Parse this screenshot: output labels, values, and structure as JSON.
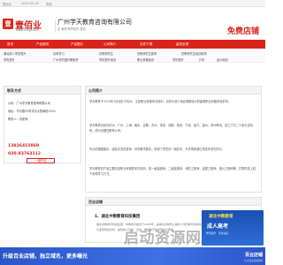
{
  "topbar": {
    "site": "壹佰业",
    "date": "2025-05-26",
    "login": "登录"
  },
  "header": {
    "logo_mark": "壹",
    "logo_text": "壹佰业",
    "logo_url": "www.100ye.com",
    "company_name": "广州学天教育咨询有限公司",
    "company_tags": "企 管理  教育培训  咨询",
    "free_store": "免费店铺"
  },
  "nav": {
    "items": [
      "首页",
      "产品服务",
      "产品图片",
      "公司简介",
      "文件下载",
      "留言反馈"
    ]
  },
  "subnav": {
    "items": [
      "湖北成人学历提升",
      "自考学习",
      "在职研究生",
      "在职研究生报考",
      "在职研究生培训机构",
      "学历提升",
      "广州学历提升哪家好",
      "学历提升培训",
      "职业资格培训",
      "学历提升",
      "升本",
      "会计培训"
    ]
  },
  "contact": {
    "title": "联系方式",
    "company": "公司：广州学天教育咨询有限公司",
    "address": "地址：华乐路53号华乐大厦南塔1504",
    "person": "联系人：刘老师",
    "mobile": "13826415869",
    "tel": "020-83763112",
    "button": "一键开店"
  },
  "intro": {
    "title": "公司简介",
    "para1": "学天教育于2015年1月创办于杭州，主营职业资格考试培训，目前为浙江地区规模较大的建筑职业资格考培机构。",
    "para2": "学天教育目前在杭州、广州、上海、南京、合肥、苏州、重庆、成都、西安、宁波、绍兴、温州、郑州等地，设立了约二十家分支机构，成为全国性教育公司。",
    "para3": "专业的课程团队，经验丰富的讲师，好的教学服务，获得了学员的一致好评，升学率和通过率连年领先同行。",
    "para4": "学天教育的产品主要包括职业资格类考试培训，如一级建造师、二级建造师、消防工程师、监理工程师、造价工程师等，并提供线上线下多种学习方式。"
  },
  "shop": {
    "title": "百业店铺",
    "item_title": "1、湖北中教教育科技集团",
    "item_desc1": "湖北中教教育科技集团，中教教育始创于2003年，是湖北省较早从事成人学历教育的机构之一，",
    "item_desc2": "与多所院校合作，提供成人高考、自考、网络教育等学历提升服务。"
  },
  "ad": {
    "top": "湖北中教教育",
    "mid": "成人高考",
    "bot": "学历提升 · 专本连读"
  },
  "footer": {
    "text": "升级百业店铺，独立域名，更多曝光",
    "logo": "百业店铺",
    "sub": "让企业生意更简单"
  },
  "watermark": "启动资源网"
}
